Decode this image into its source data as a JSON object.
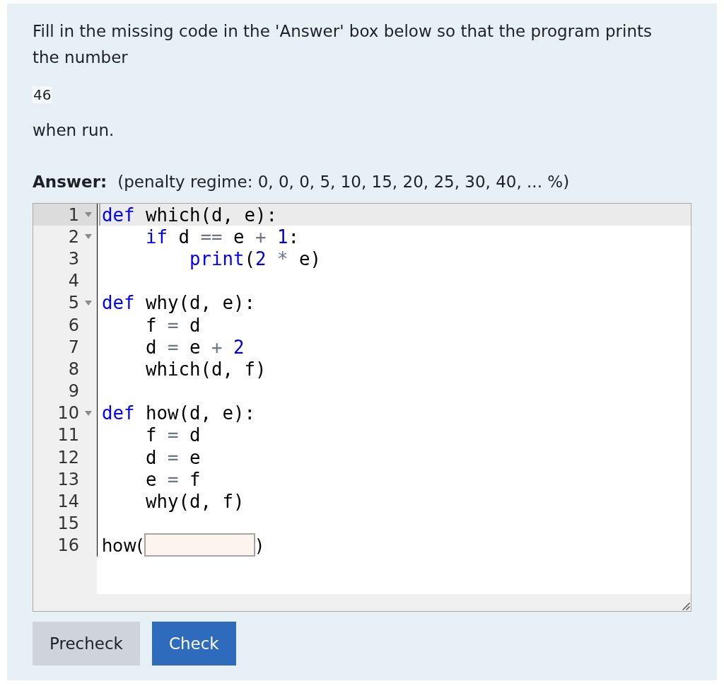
{
  "question": {
    "prompt": "Fill in the missing code in the 'Answer' box below so that the program prints the number",
    "expected_output": "46",
    "closing": "when run."
  },
  "answer": {
    "label": "Answer:",
    "penalty_regime": "(penalty regime: 0, 0, 0, 5, 10, 15, 20, 25, 30, 40, ... %)"
  },
  "editor": {
    "lines": [
      {
        "number": "1",
        "foldable": true,
        "active": true,
        "tokens": [
          {
            "text": "def",
            "kind": "keyword"
          },
          {
            "text": " which(d, e):",
            "kind": "plain"
          }
        ]
      },
      {
        "number": "2",
        "foldable": true,
        "active": false,
        "tokens": [
          {
            "text": "    if",
            "kind": "keyword"
          },
          {
            "text": " d ",
            "kind": "plain"
          },
          {
            "text": "==",
            "kind": "operator"
          },
          {
            "text": " e ",
            "kind": "plain"
          },
          {
            "text": "+",
            "kind": "operator"
          },
          {
            "text": " 1",
            "kind": "number"
          },
          {
            "text": ":",
            "kind": "plain"
          }
        ]
      },
      {
        "number": "3",
        "foldable": false,
        "active": false,
        "tokens": [
          {
            "text": "        print",
            "kind": "builtin"
          },
          {
            "text": "(",
            "kind": "plain"
          },
          {
            "text": "2 ",
            "kind": "number"
          },
          {
            "text": "*",
            "kind": "operator"
          },
          {
            "text": " e)",
            "kind": "plain"
          }
        ]
      },
      {
        "number": "4",
        "foldable": false,
        "active": false
      },
      {
        "number": "5",
        "foldable": true,
        "active": false,
        "tokens": [
          {
            "text": "def",
            "kind": "keyword"
          },
          {
            "text": " why(d, e):",
            "kind": "plain"
          }
        ]
      },
      {
        "number": "6",
        "foldable": false,
        "active": false,
        "tokens": [
          {
            "text": "    f ",
            "kind": "plain"
          },
          {
            "text": "=",
            "kind": "operator"
          },
          {
            "text": " d",
            "kind": "plain"
          }
        ]
      },
      {
        "number": "7",
        "foldable": false,
        "active": false,
        "tokens": [
          {
            "text": "    d ",
            "kind": "plain"
          },
          {
            "text": "=",
            "kind": "operator"
          },
          {
            "text": " e ",
            "kind": "plain"
          },
          {
            "text": "+",
            "kind": "operator"
          },
          {
            "text": " 2",
            "kind": "number"
          }
        ]
      },
      {
        "number": "8",
        "foldable": false,
        "active": false,
        "tokens": [
          {
            "text": "    which(d, f)",
            "kind": "plain"
          }
        ]
      },
      {
        "number": "9",
        "foldable": false,
        "active": false
      },
      {
        "number": "10",
        "foldable": true,
        "active": false,
        "tokens": [
          {
            "text": "def",
            "kind": "keyword"
          },
          {
            "text": " how(d, e):",
            "kind": "plain"
          }
        ]
      },
      {
        "number": "11",
        "foldable": false,
        "active": false,
        "tokens": [
          {
            "text": "    f ",
            "kind": "plain"
          },
          {
            "text": "=",
            "kind": "operator"
          },
          {
            "text": " d",
            "kind": "plain"
          }
        ]
      },
      {
        "number": "12",
        "foldable": false,
        "active": false,
        "tokens": [
          {
            "text": "    d ",
            "kind": "plain"
          },
          {
            "text": "=",
            "kind": "operator"
          },
          {
            "text": " e",
            "kind": "plain"
          }
        ]
      },
      {
        "number": "13",
        "foldable": false,
        "active": false,
        "tokens": [
          {
            "text": "    e ",
            "kind": "plain"
          },
          {
            "text": "=",
            "kind": "operator"
          },
          {
            "text": " f",
            "kind": "plain"
          }
        ]
      },
      {
        "number": "14",
        "foldable": false,
        "active": false,
        "tokens": [
          {
            "text": "    why(d, f)",
            "kind": "plain"
          }
        ]
      },
      {
        "number": "15",
        "foldable": false,
        "active": false
      },
      {
        "number": "16",
        "foldable": false,
        "active": false,
        "tokens": [
          {
            "text": "how(",
            "kind": "prose"
          },
          {
            "kind": "blank"
          },
          {
            "text": ")",
            "kind": "prose"
          }
        ]
      }
    ]
  },
  "buttons": [
    {
      "label": "Precheck",
      "kind": "secondary"
    },
    {
      "label": "Check",
      "kind": "primary"
    }
  ]
}
